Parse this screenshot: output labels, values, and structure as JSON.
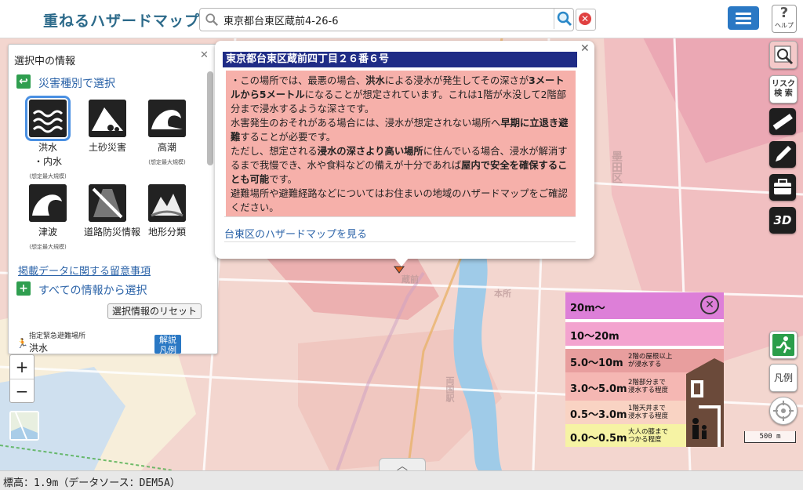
{
  "header": {
    "app_title": "重ねるハザードマップ",
    "search_value": "東京都台東区蔵前4-26-6",
    "help_label": "ヘルプ"
  },
  "left_panel": {
    "title": "選択中の情報",
    "section1": "災害種別で選択",
    "hazards": [
      {
        "label": "洪水",
        "sub_label": "・内水",
        "note": "(想定最大規模)",
        "icon": "flood-icon",
        "selected": true
      },
      {
        "label": "土砂災害",
        "note": "",
        "icon": "landslide-icon",
        "selected": false
      },
      {
        "label": "高潮",
        "note": "(想定最大規模)",
        "icon": "storm-surge-icon",
        "selected": false
      },
      {
        "label": "津波",
        "note": "(想定最大規模)",
        "icon": "tsunami-icon",
        "selected": false
      },
      {
        "label": "道路防災情報",
        "note": "",
        "icon": "road-disaster-icon",
        "selected": false
      },
      {
        "label": "地形分類",
        "note": "",
        "icon": "terrain-icon",
        "selected": false
      }
    ],
    "notice_link": "掲載データに関する留意事項",
    "section2": "すべての情報から選択",
    "reset_button": "選択情報のリセット",
    "shelter_label": "指定緊急避難場所",
    "shelter_value": "洪水",
    "explain_button_line1": "解説",
    "explain_button_line2": "凡例"
  },
  "popup": {
    "address": "東京都台東区蔵前四丁目２６番６号",
    "para1_a": "・この場所では、最悪の場合、",
    "para1_b": "洪水",
    "para1_c": "による浸水が発生してその深さが",
    "para1_d": "3メートルから5メートル",
    "para1_e": "になることが想定されています。これは1階が水没して2階部分まで浸水するような深さです。",
    "para2_a": "水害発生のおそれがある場合には、浸水が想定されない場所へ",
    "para2_b": "早期に立退き避難",
    "para2_c": "することが必要です。",
    "para3_a": "ただし、想定される",
    "para3_b": "浸水の深さより高い場所",
    "para3_c": "に住んでいる場合、浸水が解消するまで我慢でき、水や食料などの備えが十分であれば",
    "para3_d": "屋内で安全を確保することも可能",
    "para3_e": "です。",
    "para4": "避難場所や避難経路などについてはお住まいの地域のハザードマップをご確認ください。",
    "link": "台東区のハザードマップを見る"
  },
  "tools": {
    "risk_search_line1": "リスク",
    "risk_search_line2": "検 索",
    "three_d": "3D",
    "legend_button": "凡例"
  },
  "legend": {
    "rows": [
      {
        "range": "20m〜",
        "desc": "",
        "color": "#dd7fd8"
      },
      {
        "range": "10〜20m",
        "desc": "",
        "color": "#f3a3cf"
      },
      {
        "range": "5.0〜10m",
        "desc1": "2階の屋根以上",
        "desc2": "が浸水する",
        "color": "#e89e9e"
      },
      {
        "range": "3.0〜5.0m",
        "desc1": "2階部分まで",
        "desc2": "浸水する程度",
        "color": "#f5b7b3"
      },
      {
        "range": "0.5〜3.0m",
        "desc1": "1階天井まで",
        "desc2": "浸水する程度",
        "color": "#f9d3c3"
      },
      {
        "range": "0.0〜0.5m",
        "desc1": "大人の膝まで",
        "desc2": "つかる程度",
        "color": "#f6f3a4"
      }
    ]
  },
  "map": {
    "labels": [
      "墨田区",
      "本所",
      "両国駅",
      "蔵前"
    ],
    "zoom_in": "+",
    "zoom_out": "−",
    "scale": "500 m",
    "up_arrow": "︿"
  },
  "status": {
    "text": "標高：1.9m（データソース：DEM5A）"
  },
  "colors": {
    "accent": "#2a78c4",
    "popup_head": "#1f2c86",
    "popup_body": "#f6b0aa"
  }
}
